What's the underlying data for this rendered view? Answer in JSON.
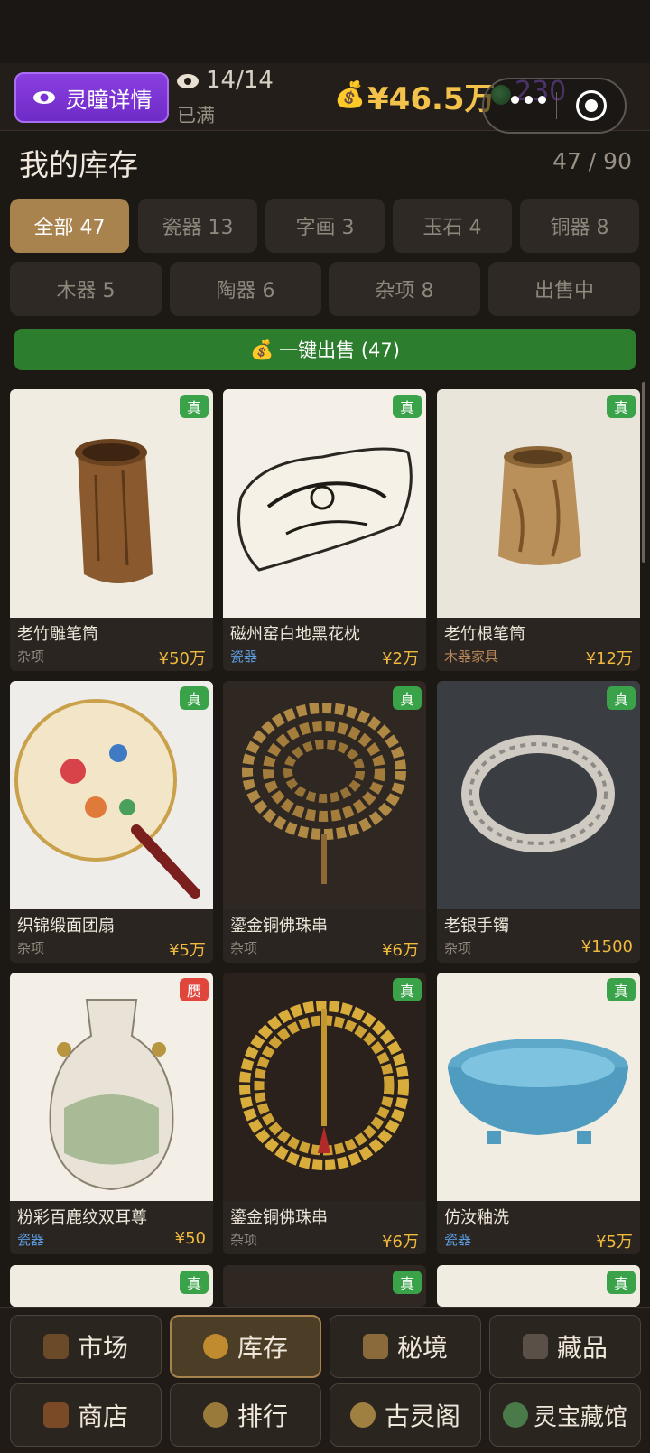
{
  "header": {
    "detail_button": "灵瞳详情",
    "slots": "14/14",
    "slots_status": "已满",
    "money": "¥46.5万",
    "jade": "230",
    "money_icon": "💰"
  },
  "inventory": {
    "title": "我的库存",
    "capacity": "47 / 90",
    "tabs": [
      {
        "label": "全部 47",
        "active": true
      },
      {
        "label": "瓷器 13"
      },
      {
        "label": "字画 3"
      },
      {
        "label": "玉石 4"
      },
      {
        "label": "铜器 8"
      },
      {
        "label": "木器 5"
      },
      {
        "label": "陶器 6"
      },
      {
        "label": "杂项 8"
      },
      {
        "label": "出售中"
      }
    ],
    "sell_all": "一键出售 (47)",
    "items": [
      {
        "name": "老竹雕笔筒",
        "category": "杂项",
        "price": "¥50万",
        "badge": "真"
      },
      {
        "name": "磁州窑白地黑花枕",
        "category": "瓷器",
        "price": "¥2万",
        "badge": "真"
      },
      {
        "name": "老竹根笔筒",
        "category": "木器家具",
        "price": "¥12万",
        "badge": "真"
      },
      {
        "name": "织锦缎面团扇",
        "category": "杂项",
        "price": "¥5万",
        "badge": "真"
      },
      {
        "name": "鎏金铜佛珠串",
        "category": "杂项",
        "price": "¥6万",
        "badge": "真"
      },
      {
        "name": "老银手镯",
        "category": "杂项",
        "price": "¥1500",
        "badge": "真"
      },
      {
        "name": "粉彩百鹿纹双耳尊",
        "category": "瓷器",
        "price": "¥50",
        "badge": "赝"
      },
      {
        "name": "鎏金铜佛珠串",
        "category": "杂项",
        "price": "¥6万",
        "badge": "真"
      },
      {
        "name": "仿汝釉洗",
        "category": "瓷器",
        "price": "¥5万",
        "badge": "真"
      },
      {
        "badge": "真"
      },
      {
        "badge": "真"
      },
      {
        "badge": "真"
      }
    ]
  },
  "nav": {
    "market": "市场",
    "inventory": "库存",
    "secret_realm": "秘境",
    "collection": "藏品",
    "shop": "商店",
    "ranking": "排行",
    "pavilion": "古灵阁",
    "museum": "灵宝藏馆"
  },
  "colors": {
    "accent": "#a8834e",
    "real_badge": "#3aa34a",
    "fake_badge": "#e0463c",
    "price": "#f0b93d",
    "category_porcelain": "#5b9be0",
    "category_misc": "#8f877c",
    "category_wood": "#b8875a"
  }
}
